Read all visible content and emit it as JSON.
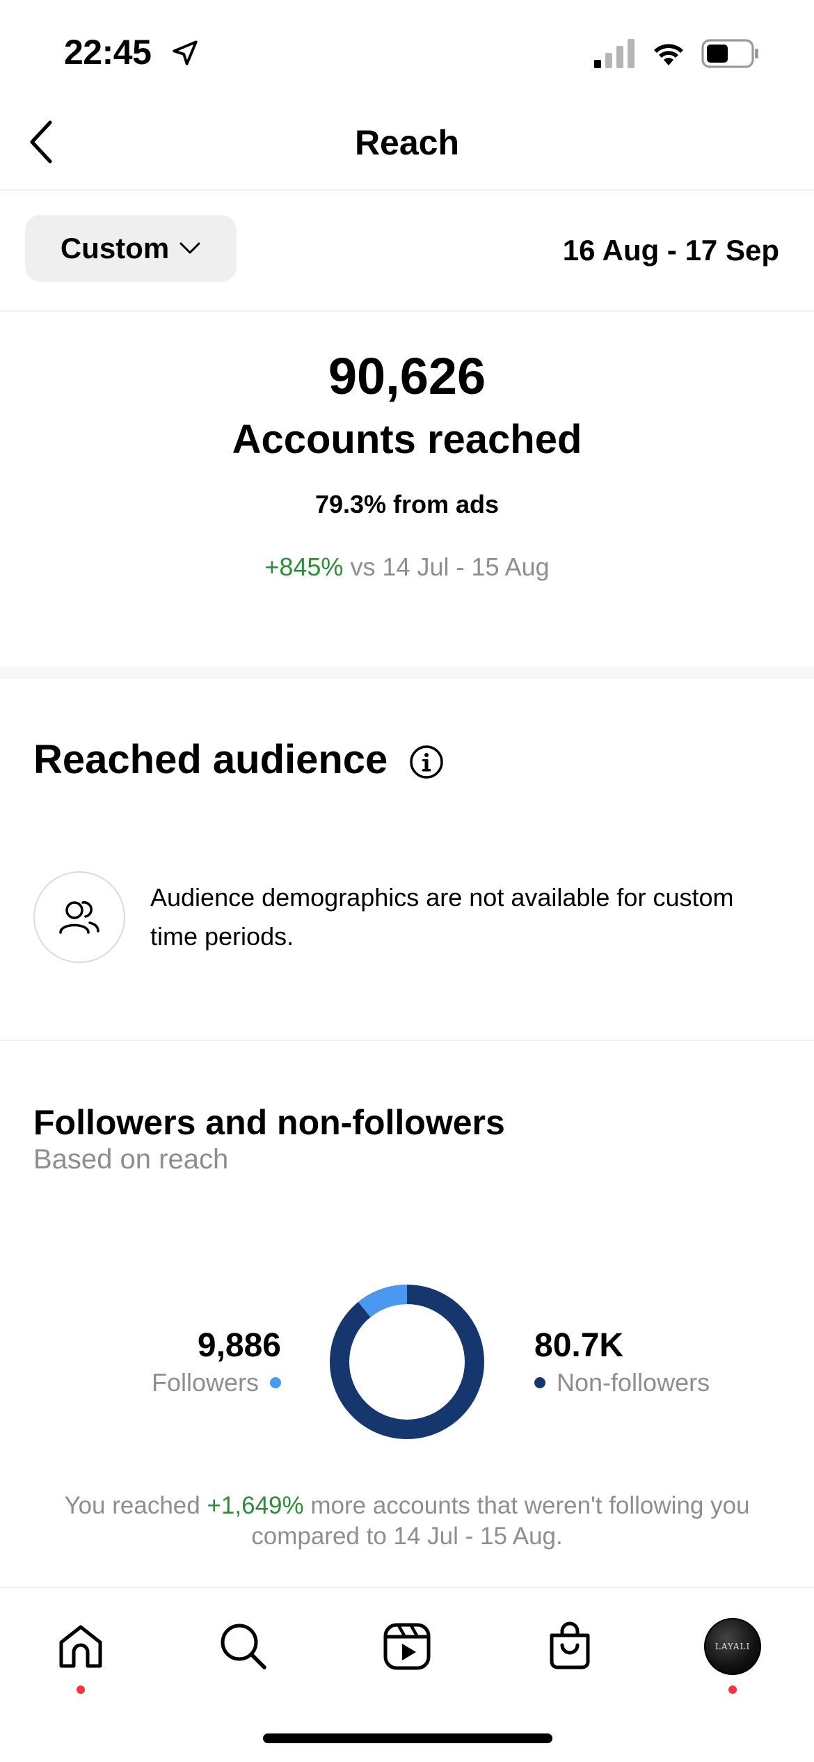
{
  "status_bar": {
    "time": "22:45",
    "icons": [
      "location-arrow-icon",
      "cellular-signal-icon",
      "wifi-icon",
      "battery-icon"
    ]
  },
  "navbar": {
    "title": "Reach",
    "back_icon": "chevron-left-icon"
  },
  "filter": {
    "dropdown_label": "Custom",
    "dropdown_icon": "chevron-down-icon",
    "date_range": "16 Aug - 17 Sep"
  },
  "summary": {
    "accounts_reached_value": "90,626",
    "accounts_reached_label": "Accounts reached",
    "from_ads": "79.3% from ads",
    "change_percent": "+845%",
    "change_text": "vs 14 Jul - 15 Aug"
  },
  "reached_audience": {
    "title": "Reached audience",
    "info_icon": "info-icon",
    "people_icon": "people-icon",
    "message": "Audience demographics are not available for custom time periods."
  },
  "followers_section": {
    "title": "Followers and non-followers",
    "subtitle": "Based on reach",
    "followers_value": "9,886",
    "followers_label": "Followers",
    "non_followers_value": "80.7K",
    "non_followers_label": "Non-followers",
    "followers_share": 0.109,
    "colors": {
      "followers": "#4a98f0",
      "non_followers": "#16366e"
    },
    "note_prefix": "You reached",
    "note_highlight": "+1,649%",
    "note_suffix": "more accounts that weren't following you compared to 14 Jul - 15 Aug."
  },
  "tab_bar": {
    "tabs": [
      {
        "icon": "home-icon",
        "has_dot": true
      },
      {
        "icon": "search-icon",
        "has_dot": false
      },
      {
        "icon": "reels-icon",
        "has_dot": false
      },
      {
        "icon": "shop-icon",
        "has_dot": false
      },
      {
        "icon": "profile-avatar",
        "has_dot": true
      }
    ],
    "avatar_text": "LAYALI"
  },
  "colors": {
    "positive": "#2e8b3a",
    "muted_text": "#8e8e8e",
    "notification_dot": "#ff3040"
  }
}
